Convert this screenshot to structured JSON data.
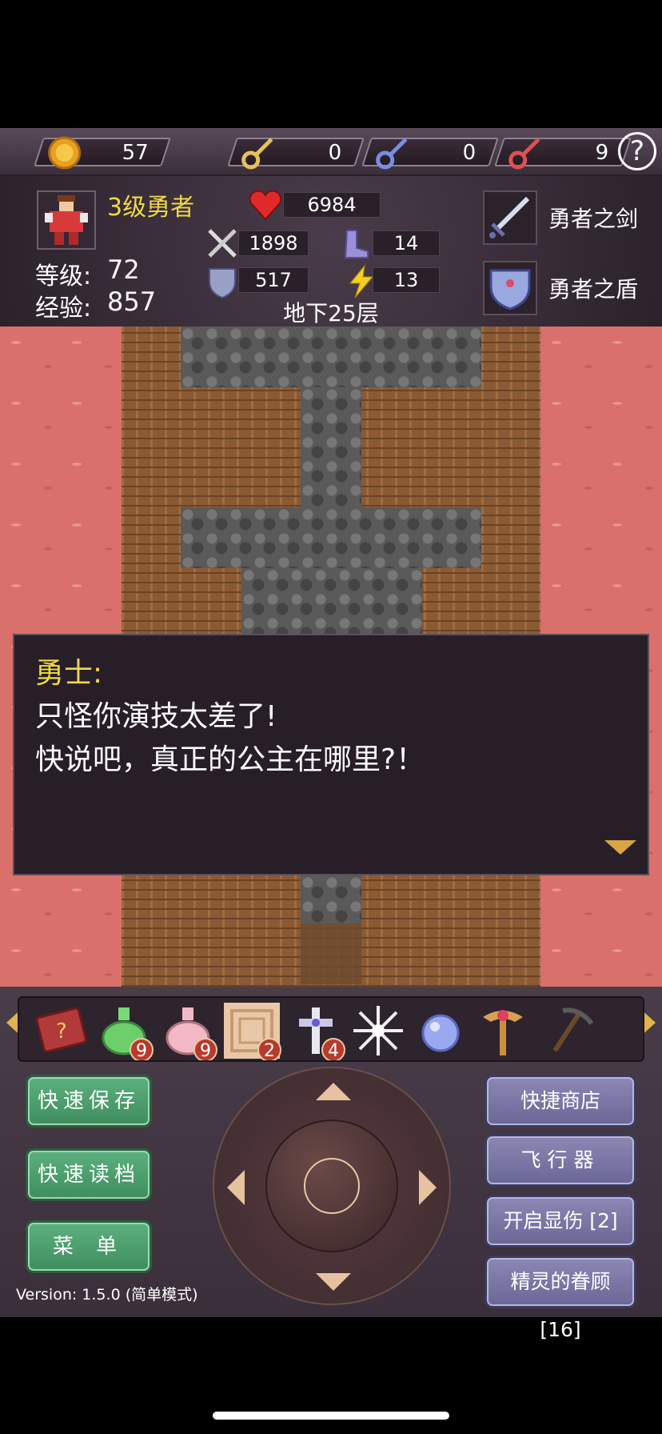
{
  "resources": {
    "gold": "57",
    "yellow_keys": "0",
    "blue_keys": "0",
    "red_keys": "9"
  },
  "help_label": "?",
  "hero": {
    "title": "3级勇者",
    "level_label": "等级:",
    "level_value": "72",
    "exp_label": "经验:",
    "exp_value": "857"
  },
  "stats": {
    "hp": "6984",
    "attack": "1898",
    "defense": "517",
    "magic_defense": "14",
    "agility": "13"
  },
  "equipment": {
    "weapon": "勇者之剑",
    "shield": "勇者之盾"
  },
  "floor": "地下25层",
  "dialog": {
    "speaker": "勇士:",
    "line1": "只怪你演技太差了!",
    "line2": "快说吧，真正的公主在哪里?！"
  },
  "items": [
    {
      "icon": "monster-book-icon",
      "count": ""
    },
    {
      "icon": "green-potion-icon",
      "count": "9"
    },
    {
      "icon": "pink-potion-icon",
      "count": "9"
    },
    {
      "icon": "scroll-icon",
      "count": "2"
    },
    {
      "icon": "cross-icon",
      "count": "4"
    },
    {
      "icon": "snowflake-icon",
      "count": ""
    },
    {
      "icon": "orb-icon",
      "count": ""
    },
    {
      "icon": "staff-icon",
      "count": ""
    },
    {
      "icon": "pickaxe-icon",
      "count": ""
    }
  ],
  "buttons": {
    "quick_save": "快速保存",
    "quick_load": "快速读档",
    "menu": "菜 单",
    "shop": "快捷商店",
    "fly": "飞行器",
    "show_damage": "开启显伤 [2]",
    "spirit": "精灵的眷顾 [16]"
  },
  "version": "Version: 1.5.0 (简单模式)",
  "colors": {
    "title_yellow": "#f0d94a",
    "green_button": "#4f9f6f",
    "purple_button": "#7b78a6",
    "lava": "#d9706c"
  }
}
